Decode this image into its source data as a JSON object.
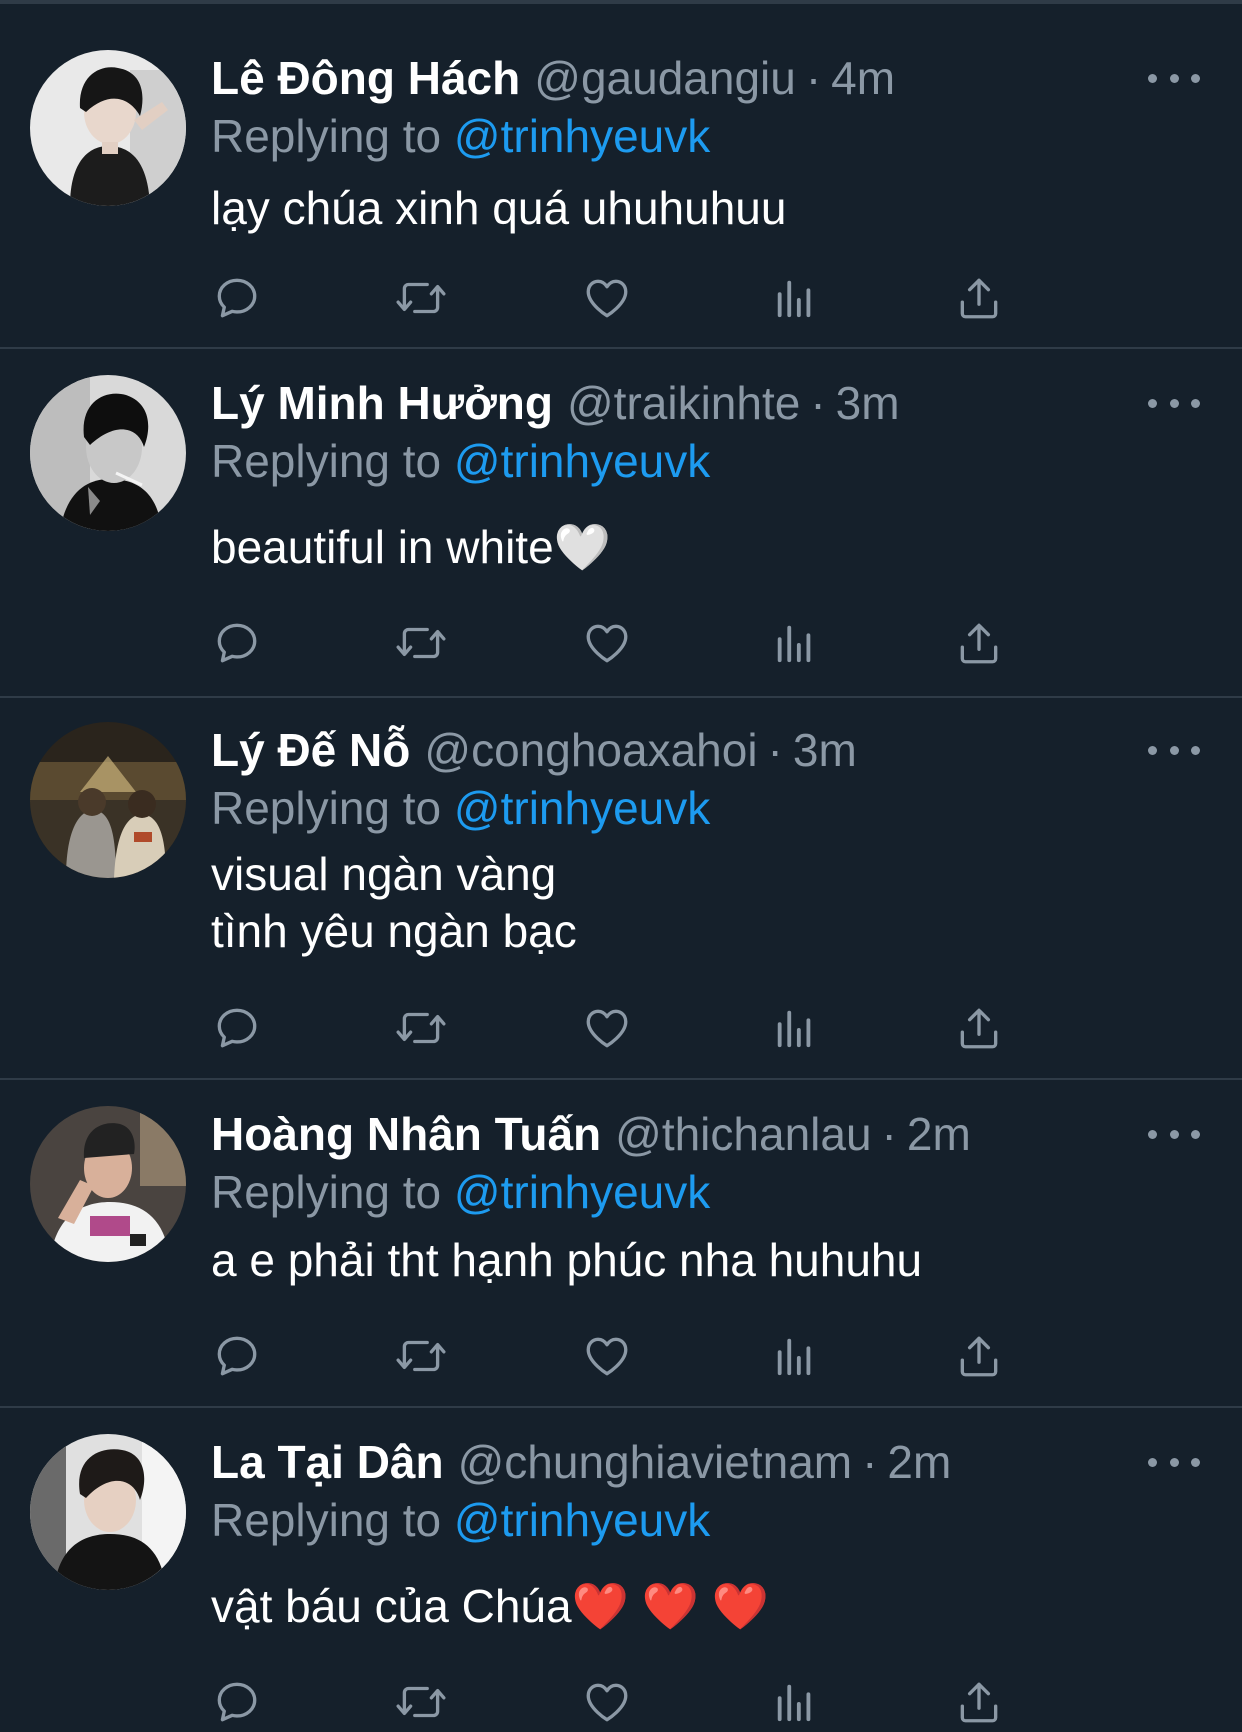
{
  "ui": {
    "colors": {
      "background": "#15202b",
      "divider": "#2f3b47",
      "secondary_text": "#8b98a5",
      "link": "#1d9bf0"
    },
    "separator": "·",
    "replying_label": "Replying to",
    "action_icons": [
      "reply-icon",
      "retweet-icon",
      "like-icon",
      "views-icon",
      "share-icon"
    ]
  },
  "tweets": [
    {
      "display_name": "Lê Đông Hách",
      "handle": "@gaudangiu",
      "time": "4m",
      "reply_to": "@trinhyeuvk",
      "text": "lạy chúa xinh quá uhuhuhuu"
    },
    {
      "display_name": "Lý Minh Hưởng",
      "handle": "@traikinhte",
      "time": "3m",
      "reply_to": "@trinhyeuvk",
      "text": "beautiful in white🤍",
      "emoji": "white-heart-emoji"
    },
    {
      "display_name": "Lý Đế Nỗ",
      "handle": "@conghoaxahoi",
      "time": "3m",
      "reply_to": "@trinhyeuvk",
      "text": "visual ngàn vàng\ntình yêu ngàn bạc"
    },
    {
      "display_name": "Hoàng Nhân Tuấn",
      "handle": "@thichanlau",
      "time": "2m",
      "reply_to": "@trinhyeuvk",
      "text": "a e phải tht hạnh phúc nha huhuhu"
    },
    {
      "display_name": "La Tại Dân",
      "handle": "@chunghiavietnam",
      "time": "2m",
      "reply_to": "@trinhyeuvk",
      "text": "vật báu của Chúa❤️ ❤️ ❤️",
      "emoji": "red-heart-emoji"
    }
  ]
}
